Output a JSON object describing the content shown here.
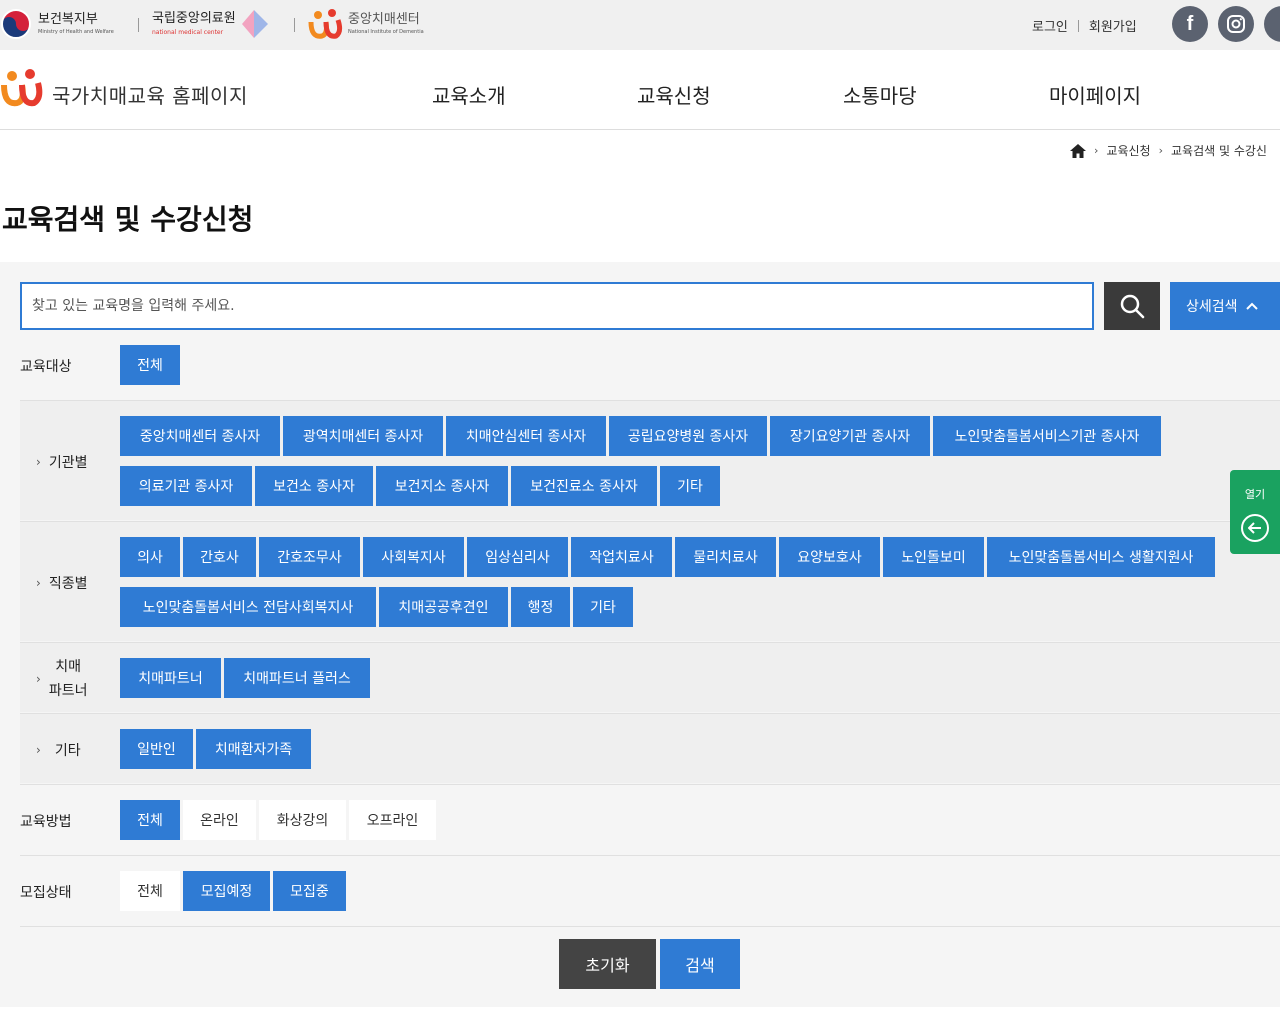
{
  "top": {
    "orgs": [
      {
        "name": "보건복지부",
        "sub": "Ministry of Health and Welfare"
      },
      {
        "name": "국립중앙의료원",
        "sub": "national medical center"
      },
      {
        "name": "중앙치매센터",
        "sub": "National Institute of Dementia"
      }
    ],
    "login": "로그인",
    "signup": "회원가입",
    "social": [
      "f"
    ]
  },
  "header": {
    "site_title": "국가치매교육 홈페이지",
    "nav": [
      "교육소개",
      "교육신청",
      "소통마당",
      "마이페이지"
    ]
  },
  "breadcrumb": [
    "교육신청",
    "교육검색 및 수강신"
  ],
  "page_title": "교육검색 및 수강신청",
  "search": {
    "placeholder": "찾고 있는 교육명을 입력해 주세요.",
    "detail_label": "상세검색"
  },
  "filters": {
    "target_label": "교육대상",
    "target_all": "전체",
    "groups": [
      {
        "label": "기관별",
        "rows": [
          [
            "중앙치매센터 종사자",
            "광역치매센터 종사자",
            "치매안심센터 종사자",
            "공립요양병원 종사자",
            "장기요양기관 종사자",
            "노인맞춤돌봄서비스기관 종사자"
          ],
          [
            "의료기관 종사자",
            "보건소 종사자",
            "보건지소 종사자",
            "보건진료소 종사자",
            "기타"
          ]
        ]
      },
      {
        "label": "직종별",
        "rows": [
          [
            "의사",
            "간호사",
            "간호조무사",
            "사회복지사",
            "임상심리사",
            "작업치료사",
            "물리치료사",
            "요양보호사",
            "노인돌보미",
            "노인맞춤돌봄서비스 생활지원사"
          ],
          [
            "노인맞춤돌봄서비스 전담사회복지사",
            "치매공공후견인",
            "행정",
            "기타"
          ]
        ]
      },
      {
        "label_lines": [
          "치매",
          "파트너"
        ],
        "rows": [
          [
            "치매파트너",
            "치매파트너 플러스"
          ]
        ]
      },
      {
        "label": "기타",
        "rows": [
          [
            "일반인",
            "치매환자가족"
          ]
        ]
      }
    ],
    "method_label": "교육방법",
    "methods": [
      "전체",
      "온라인",
      "화상강의",
      "오프라인"
    ],
    "status_label": "모집상태",
    "statuses": [
      "전체",
      "모집예정",
      "모집중"
    ]
  },
  "buttons": {
    "reset": "초기화",
    "search": "검색"
  },
  "side": {
    "open": "열기"
  }
}
